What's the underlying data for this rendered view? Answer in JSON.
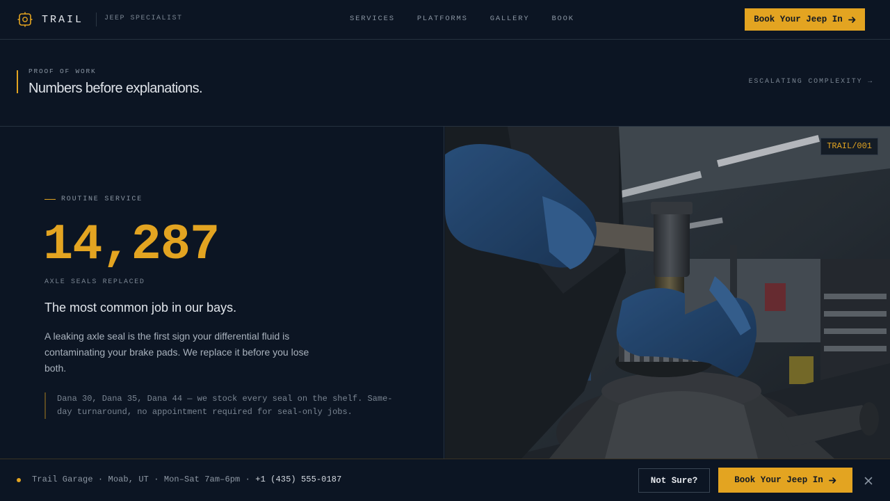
{
  "header": {
    "brand_name": "TRAIL",
    "brand_tagline": "JEEP SPECIALIST",
    "nav": [
      {
        "label": "SERVICES"
      },
      {
        "label": "PLATFORMS"
      },
      {
        "label": "GALLERY"
      },
      {
        "label": "BOOK"
      }
    ],
    "cta_label": "Book Your Jeep In"
  },
  "section": {
    "eyebrow": "PROOF OF WORK",
    "title": "Numbers before explanations.",
    "aside": "ESCALATING COMPLEXITY →"
  },
  "feature": {
    "kicker": "ROUTINE SERVICE",
    "stat_value": "14,287",
    "stat_label": "AXLE SEALS REPLACED",
    "headline": "The most common job in our bays.",
    "body": "A leaking axle seal is the first sign your differential fluid is contaminating your brake pads. We replace it before you lose both.",
    "note": "Dana 30, Dana 35, Dana 44 — we stock every seal on the shelf. Same-day turnaround, no appointment required for seal-only jobs.",
    "photo_tag": "TRAIL/001"
  },
  "footer": {
    "info": "Trail Garage · Moab, UT · Mon–Sat 7am–6pm · ",
    "phone": "+1 (435) 555-0187",
    "secondary_label": "Not Sure?",
    "cta_label": "Book Your Jeep In"
  },
  "colors": {
    "accent": "#e3a421",
    "background": "#0c1523",
    "border": "#26323f"
  },
  "icons": {
    "brand": "gear-logo-icon",
    "cta": "arrow-right-icon",
    "close": "close-icon"
  }
}
